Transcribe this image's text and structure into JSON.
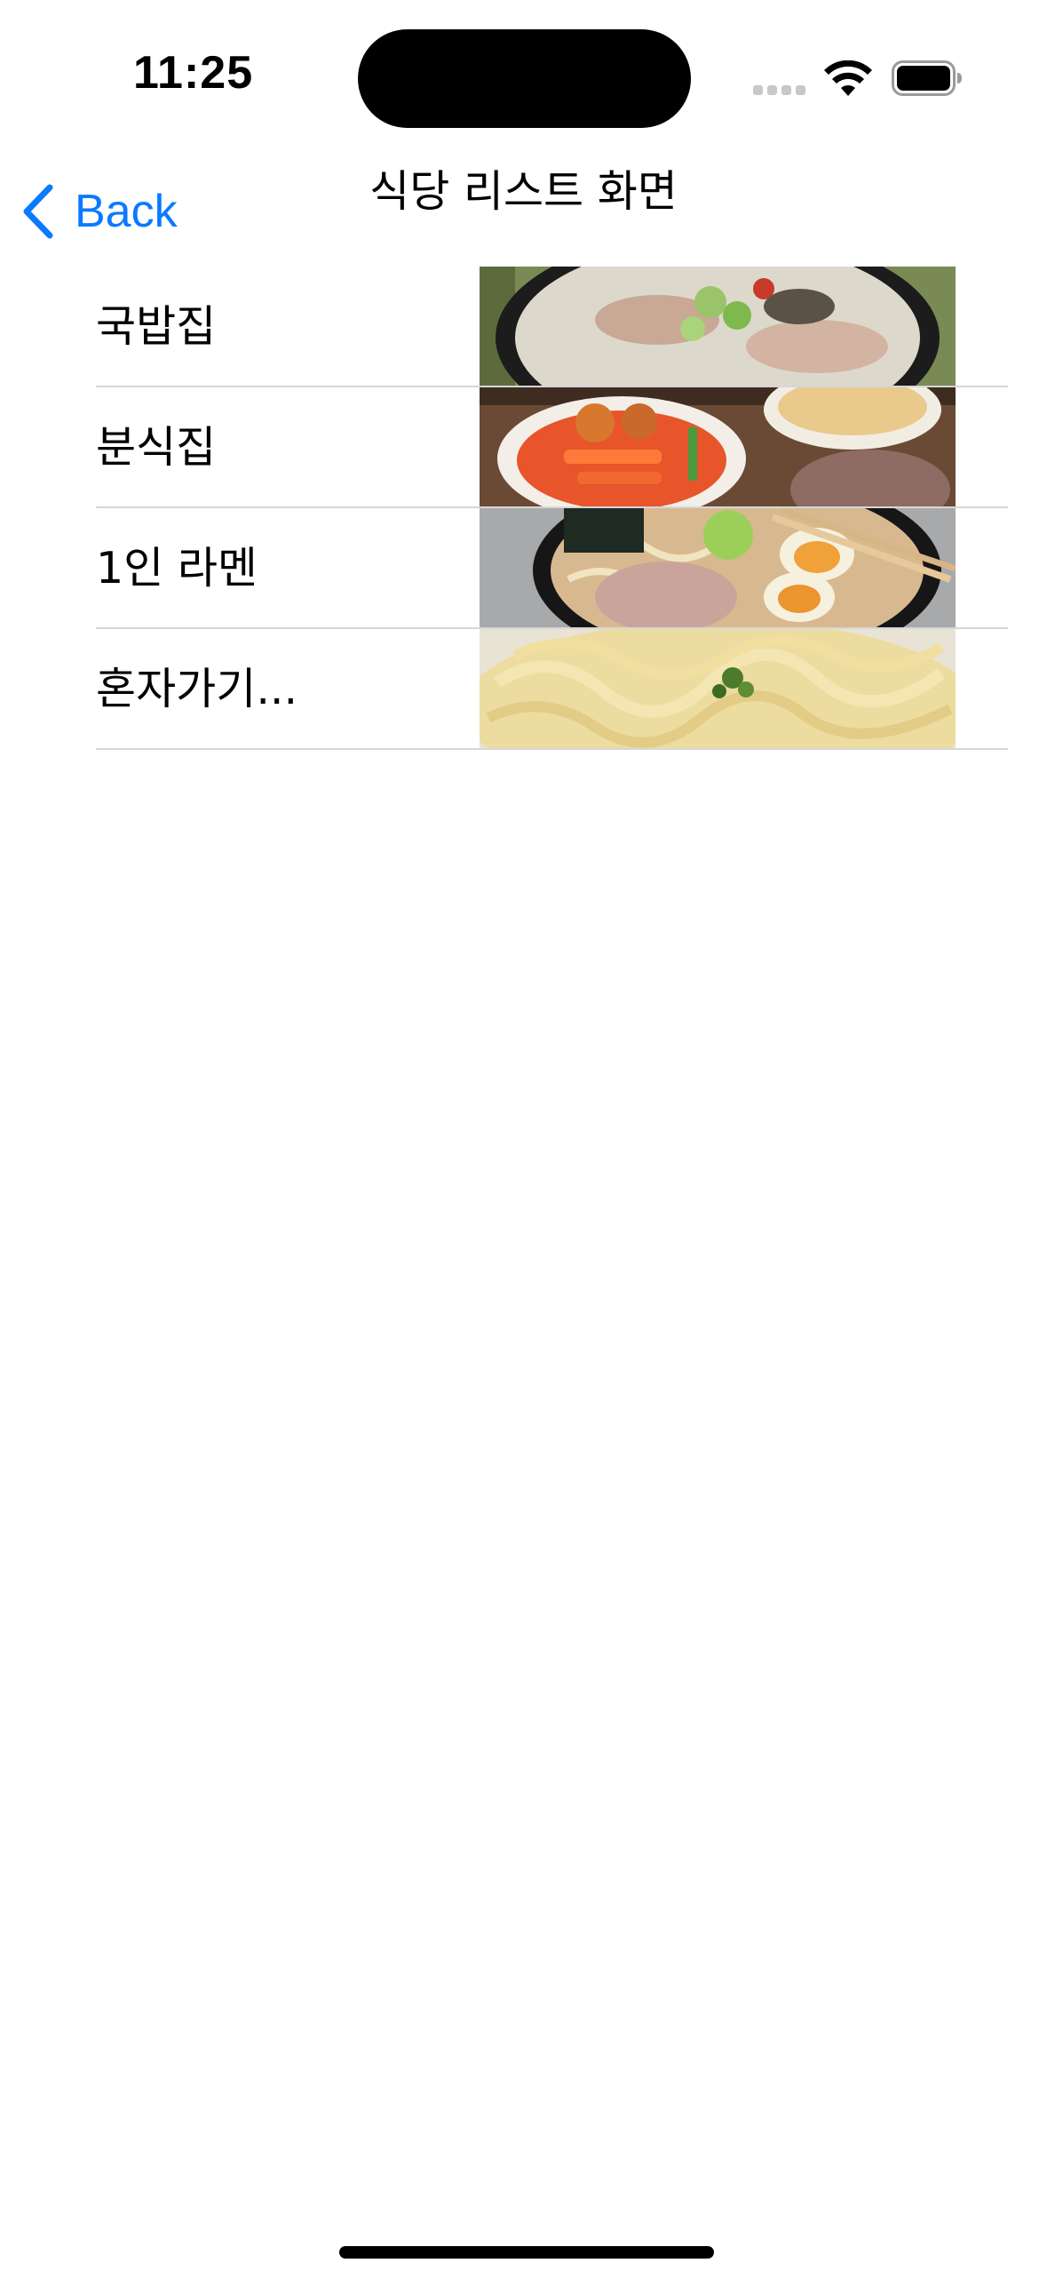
{
  "status_bar": {
    "time": "11:25",
    "icons": [
      "cellular-signal-icon",
      "wifi-icon",
      "battery-icon"
    ]
  },
  "nav_bar": {
    "back_label": "Back",
    "back_icon": "chevron-left-icon",
    "title": "식당 리스트 화면",
    "accent_color": "#0a7aff"
  },
  "restaurants": [
    {
      "name": "국밥집"
    },
    {
      "name": "분식집"
    },
    {
      "name": "1인 라멘"
    },
    {
      "name": "혼자가기..."
    }
  ]
}
